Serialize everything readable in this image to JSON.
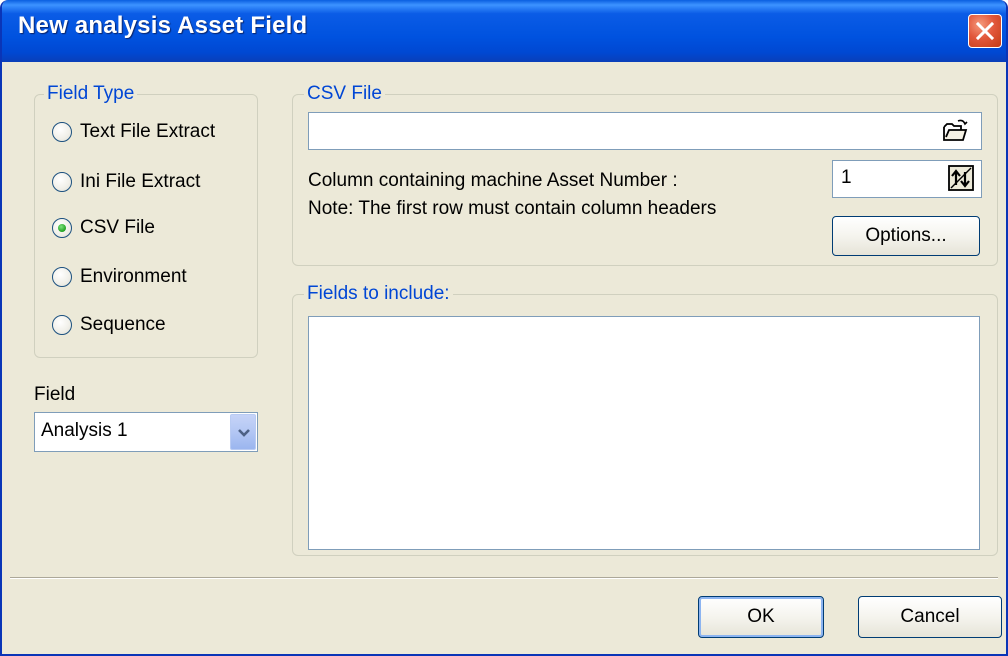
{
  "window": {
    "title": "New analysis Asset Field",
    "close_icon": "close-icon"
  },
  "field_type": {
    "legend": "Field Type",
    "selected": "CSV File",
    "options": [
      {
        "label": "Text File Extract",
        "checked": false
      },
      {
        "label": "Ini File Extract",
        "checked": false
      },
      {
        "label": "CSV File",
        "checked": true
      },
      {
        "label": "Environment",
        "checked": false
      },
      {
        "label": "Sequence",
        "checked": false
      }
    ]
  },
  "field": {
    "label": "Field",
    "selected_value": "Analysis 1"
  },
  "csv_file": {
    "legend": "CSV File",
    "path_value": "",
    "browse_icon": "open-folder-icon",
    "column_label": "Column containing machine Asset Number :",
    "note": "Note: The first row must contain column headers",
    "column_value": "1",
    "spin_icon": "spin-updown-icon",
    "options_button": "Options..."
  },
  "fields_to_include": {
    "legend": "Fields to include:",
    "items": []
  },
  "buttons": {
    "ok": "OK",
    "cancel": "Cancel"
  },
  "colors": {
    "title_bar": "#0052df",
    "group_label": "#0046d5",
    "dialog_background": "#ece9d8",
    "close_button": "#e2583c",
    "selected_radio": "#21a121"
  }
}
